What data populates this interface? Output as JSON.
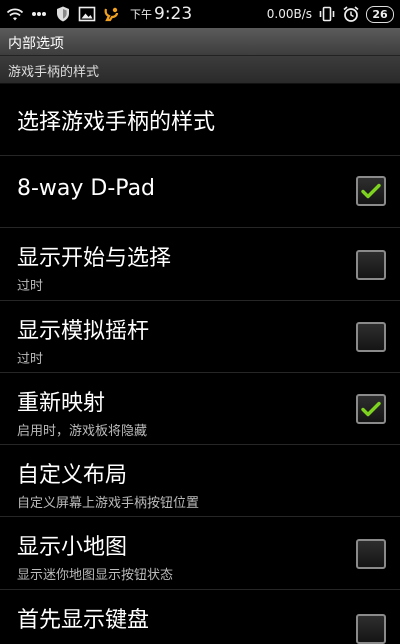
{
  "status_bar": {
    "time_prefix": "下午",
    "time": "9:23",
    "network_speed": "0.00B/s",
    "battery": "26",
    "icons": [
      "wifi-icon",
      "dots-icon",
      "shield-icon",
      "image-icon",
      "uc-browser-icon",
      "vibrate-icon",
      "alarm-icon",
      "battery-icon"
    ]
  },
  "title_bar": {
    "title": "内部选项"
  },
  "category": {
    "title": "游戏手柄的样式"
  },
  "preferences": [
    {
      "title": "选择游戏手柄的样式",
      "summary": "",
      "has_checkbox": false,
      "checked": false
    },
    {
      "title": "8-way D-Pad",
      "summary": "",
      "has_checkbox": true,
      "checked": true
    },
    {
      "title": "显示开始与选择",
      "summary": "过时",
      "has_checkbox": true,
      "checked": false
    },
    {
      "title": "显示模拟摇杆",
      "summary": "过时",
      "has_checkbox": true,
      "checked": false
    },
    {
      "title": "重新映射",
      "summary": "启用时，游戏板将隐藏",
      "has_checkbox": true,
      "checked": true
    },
    {
      "title": "自定义布局",
      "summary": "自定义屏幕上游戏手柄按钮位置",
      "has_checkbox": false,
      "checked": false
    },
    {
      "title": "显示小地图",
      "summary": "显示迷你地图显示按钮状态",
      "has_checkbox": true,
      "checked": false
    },
    {
      "title": "首先显示键盘",
      "summary": "",
      "has_checkbox": true,
      "checked": false
    }
  ],
  "colors": {
    "check_green": "#7ed321",
    "background": "#000000"
  }
}
